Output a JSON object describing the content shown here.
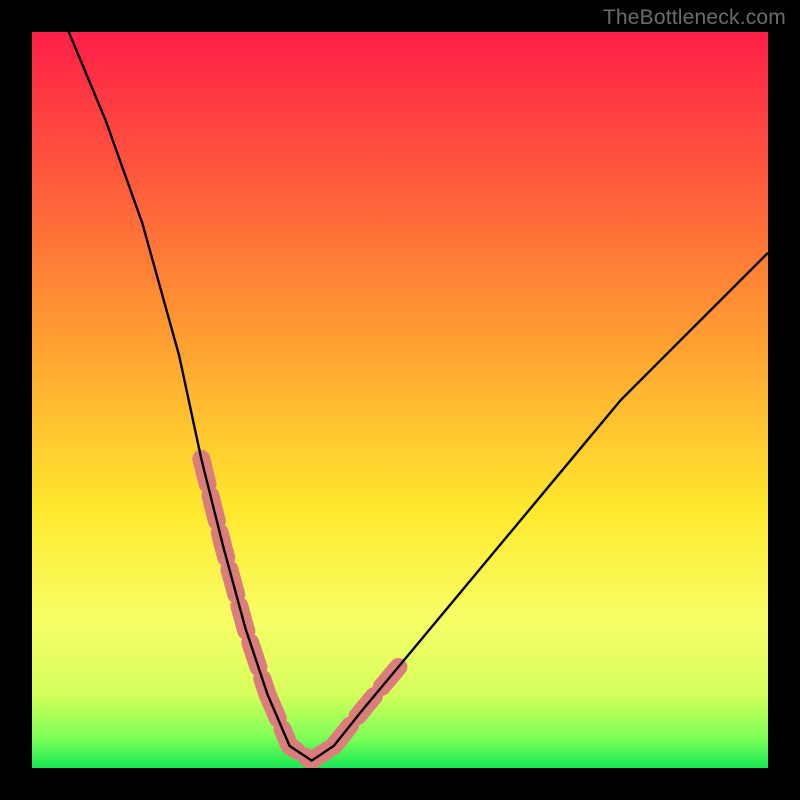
{
  "watermark": "TheBottleneck.com",
  "chart_data": {
    "type": "line",
    "title": "",
    "xlabel": "",
    "ylabel": "",
    "x_range": [
      0,
      100
    ],
    "y_range": [
      0,
      100
    ],
    "notes": "V-shaped bottleneck curve on a heat-gradient background (red=high bottleneck, green=low). Minimum (optimal match) around x≈35. No numeric axis ticks are shown; values are approximate percentages read from curve shape.",
    "series": [
      {
        "name": "bottleneck-curve",
        "color": "#000000",
        "x": [
          5,
          10,
          15,
          20,
          23,
          26,
          29,
          32,
          35,
          38,
          41,
          45,
          50,
          55,
          60,
          65,
          70,
          75,
          80,
          85,
          90,
          95,
          100
        ],
        "y": [
          100,
          88,
          74,
          56,
          42,
          30,
          19,
          10,
          3,
          1,
          3,
          8,
          14,
          20,
          26,
          32,
          38,
          44,
          50,
          55,
          60,
          65,
          70
        ]
      }
    ],
    "highlight_segments": {
      "description": "Thick salmon overlay segments marking recommended-range portions of the curve near the bottom of the V.",
      "color": "#db7d7a",
      "ranges_x": [
        [
          23,
          32
        ],
        [
          32,
          41
        ],
        [
          41,
          50
        ]
      ]
    },
    "background_gradient": {
      "stops": [
        {
          "pos": 0.0,
          "color": "#ff1f47"
        },
        {
          "pos": 0.2,
          "color": "#ff5a3c"
        },
        {
          "pos": 0.45,
          "color": "#ffa930"
        },
        {
          "pos": 0.65,
          "color": "#ffe92e"
        },
        {
          "pos": 0.8,
          "color": "#f7ff66"
        },
        {
          "pos": 0.9,
          "color": "#d4ff5a"
        },
        {
          "pos": 0.96,
          "color": "#7cff57"
        },
        {
          "pos": 1.0,
          "color": "#17e854"
        }
      ]
    }
  }
}
